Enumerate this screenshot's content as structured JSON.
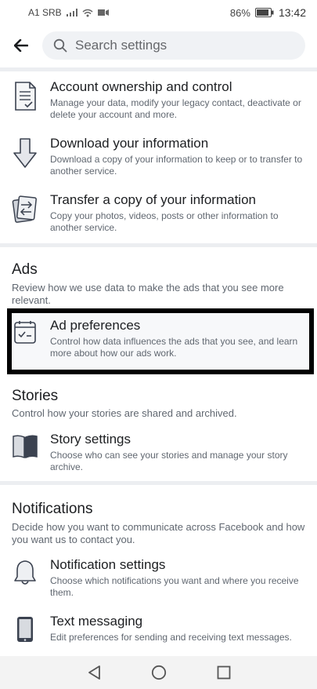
{
  "status": {
    "carrier": "A1 SRB",
    "battery": "86%",
    "time": "13:42"
  },
  "search": {
    "placeholder": "Search settings"
  },
  "your_information": {
    "items": [
      {
        "title": "Account ownership and control",
        "desc": "Manage your data, modify your legacy contact, deactivate or delete your account and more.",
        "icon": "document-icon"
      },
      {
        "title": "Download your information",
        "desc": "Download a copy of your information to keep or to transfer to another service.",
        "icon": "download-arrow-icon"
      },
      {
        "title": "Transfer a copy of your information",
        "desc": "Copy your photos, videos, posts or other information to another service.",
        "icon": "transfer-icon"
      }
    ]
  },
  "ads": {
    "title": "Ads",
    "desc": "Review how we use data to make the ads that you see more relevant.",
    "items": [
      {
        "title": "Ad preferences",
        "desc": "Control how data influences the ads that you see, and learn more about how our ads work.",
        "icon": "calendar-check-icon"
      }
    ]
  },
  "stories": {
    "title": "Stories",
    "desc": "Control how your stories are shared and archived.",
    "items": [
      {
        "title": "Story settings",
        "desc": "Choose who can see your stories and manage your story archive.",
        "icon": "book-icon"
      }
    ]
  },
  "notifications": {
    "title": "Notifications",
    "desc": "Decide how you want to communicate across Facebook and how you want us to contact you.",
    "items": [
      {
        "title": "Notification settings",
        "desc": "Choose which notifications you want and where you receive them.",
        "icon": "bell-icon"
      },
      {
        "title": "Text messaging",
        "desc": "Edit preferences for sending and receiving text messages.",
        "icon": "phone-icon"
      }
    ]
  }
}
